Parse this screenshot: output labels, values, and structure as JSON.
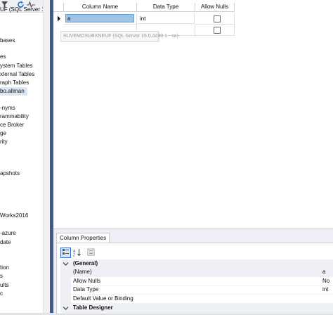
{
  "explorer": {
    "toolbar_icons": [
      "filter-icon",
      "refresh-icon",
      "activity-icon"
    ],
    "items": [
      "UF (SQL Server 15",
      "bases",
      "es",
      "ystem Tables",
      "xternal Tables",
      "raph Tables",
      "bo.allman",
      "-nyms",
      "rammability",
      "ce Broker",
      "ge",
      "rity",
      "apshots",
      "Works2016",
      "-azure",
      "date",
      "tion",
      "s",
      "ults",
      "c"
    ]
  },
  "grid": {
    "headers": {
      "column_name": "Column Name",
      "data_type": "Data Type",
      "allow_nulls": "Allow Nulls"
    },
    "rows": [
      {
        "name": "a",
        "type": "int",
        "allow_nulls": false
      }
    ]
  },
  "tooltip": {
    "text": "SUVEMOSUBXNEUF (SQL Server 15.0.4430.1 - sa)"
  },
  "column_properties": {
    "tab_label": "Column Properties",
    "rows": [
      {
        "kind": "category",
        "name": "(General)"
      },
      {
        "kind": "prop",
        "name": "(Name)",
        "value": "a"
      },
      {
        "kind": "prop",
        "name": "Allow Nulls",
        "value": "No"
      },
      {
        "kind": "prop",
        "name": "Data Type",
        "value": "int"
      },
      {
        "kind": "prop",
        "name": "Default Value or Binding",
        "value": ""
      },
      {
        "kind": "category",
        "name": "Table Designer"
      }
    ]
  },
  "colors": {
    "splitter": "#3b5c8c",
    "selected_cell": "#9dc3e6",
    "panel_bg": "#eef0f5"
  }
}
